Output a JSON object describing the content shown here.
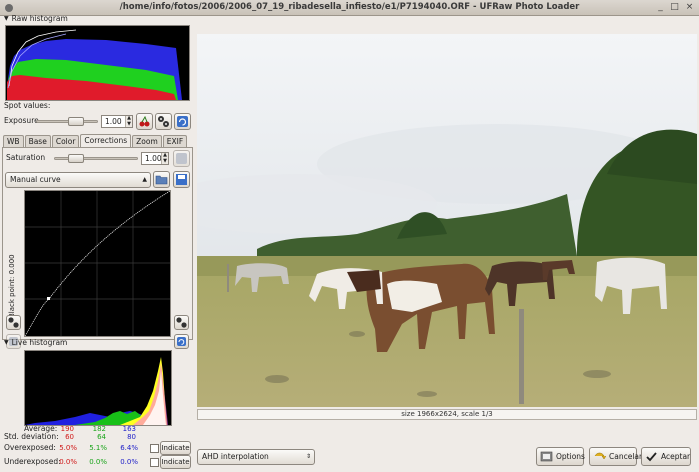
{
  "window": {
    "title": "/home/info/fotos/2006/2006_07_19_ribadesella_infiesto/e1/P7194040.ORF - UFRaw Photo Loader"
  },
  "raw_histogram": {
    "label": "Raw histogram"
  },
  "spot_values": {
    "label": "Spot values:"
  },
  "exposure": {
    "label": "Exposure",
    "value": "1.00"
  },
  "tabs": [
    {
      "label": "WB"
    },
    {
      "label": "Base"
    },
    {
      "label": "Color"
    },
    {
      "label": "Corrections"
    },
    {
      "label": "Zoom"
    },
    {
      "label": "EXIF"
    }
  ],
  "saturation": {
    "label": "Saturation",
    "value": "1.00"
  },
  "curve": {
    "selected": "Manual curve",
    "black_point_label": "Black point: 0.000"
  },
  "live_histogram": {
    "label": "Live histogram"
  },
  "stats": {
    "average": {
      "label": "Average:",
      "r": "190",
      "g": "182",
      "b": "163"
    },
    "std": {
      "label": "Std. deviation:",
      "r": "60",
      "g": "64",
      "b": "80"
    },
    "over": {
      "label": "Overexposed:",
      "r": "5.0%",
      "g": "5.1%",
      "b": "6.4%",
      "button": "Indicate"
    },
    "under": {
      "label": "Underexposed:",
      "r": "0.0%",
      "g": "0.0%",
      "b": "0.0%",
      "button": "Indicate"
    }
  },
  "preview": {
    "size_label": "size 1966x2624, scale 1/3"
  },
  "bottom": {
    "interpolation": "AHD interpolation",
    "options": "Options",
    "cancel": "Cancelar",
    "accept": "Aceptar"
  },
  "colors": {
    "red": "#e01818",
    "green": "#18c018",
    "blue": "#2020e0",
    "accent": "#8a857f"
  }
}
